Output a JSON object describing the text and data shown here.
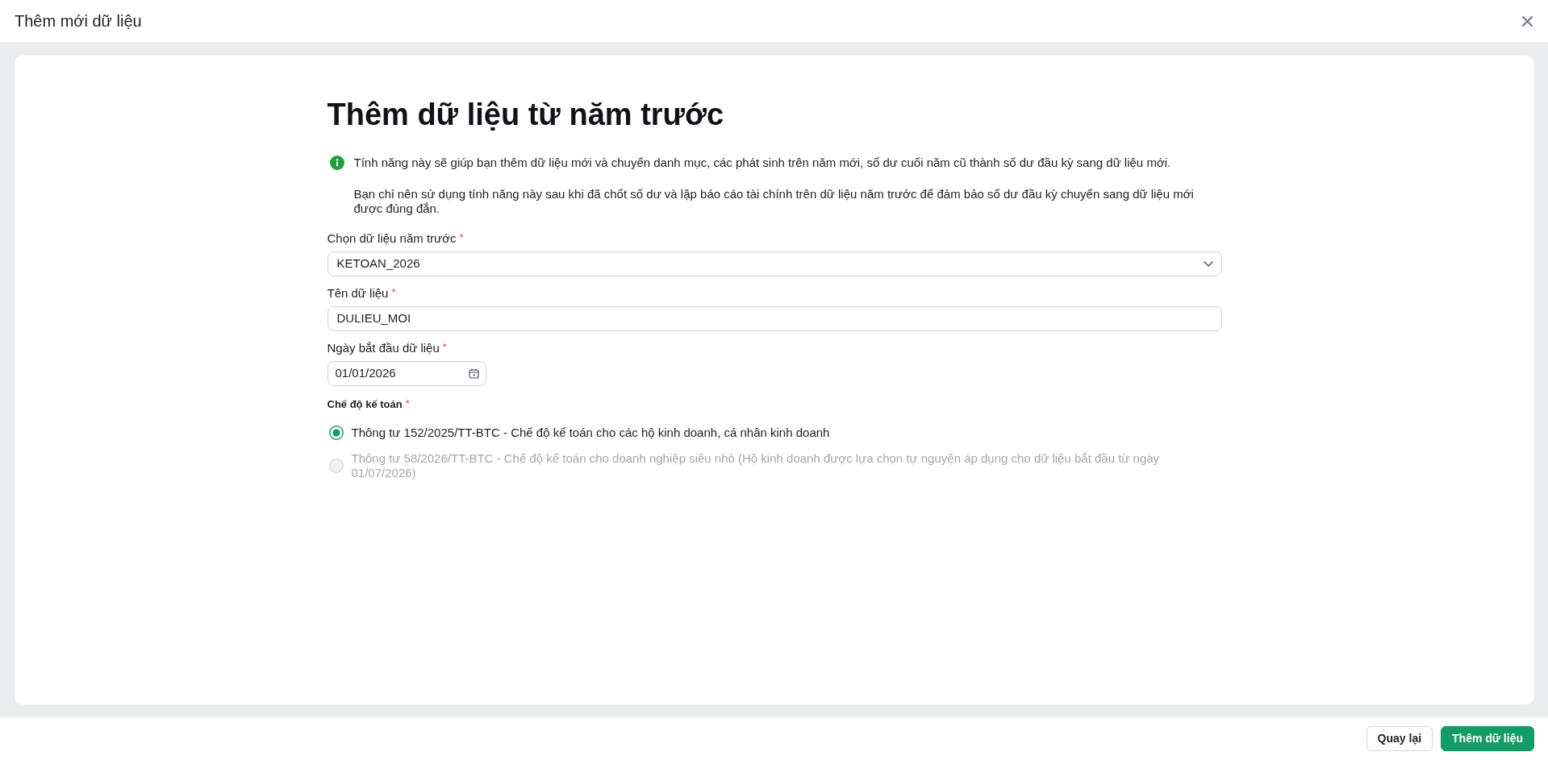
{
  "window": {
    "title": "Thêm mới dữ liệu"
  },
  "page": {
    "heading": "Thêm dữ liệu từ năm trước",
    "info": [
      "Tính năng này sẽ giúp bạn thêm dữ liệu mới và chuyển danh mục, các phát sinh trên năm mới, số dư cuối năm cũ thành số dư đầu kỳ sang dữ liệu mới.",
      "Bạn chỉ nên sử dụng tính năng này sau khi đã chốt số dư và lập báo cáo tài chính trên dữ liệu năm trước để đảm bảo số dư đầu kỳ chuyển sang dữ liệu mới được đúng đắn."
    ]
  },
  "form": {
    "fields": [
      {
        "kind": "select",
        "label": "Chọn dữ liệu năm trước",
        "required_mark": "*",
        "value": "KETOAN_2026"
      },
      {
        "kind": "text",
        "label": "Tên dữ liệu",
        "required_mark": "*",
        "value": "DULIEU_MOI"
      },
      {
        "kind": "date",
        "label": "Ngày bắt đầu dữ liệu",
        "required_mark": "*",
        "value": "01/01/2026"
      }
    ],
    "accounting_mode": {
      "label": "Chế độ kế toán",
      "required_mark": "*",
      "options": [
        {
          "label": "Thông tư 152/2025/TT-BTC - Chế độ kế toán cho các hộ kinh doanh, cá nhân kinh doanh",
          "selected": true,
          "disabled": false
        },
        {
          "label": "Thông tư 58/2026/TT-BTC - Chế độ kế toán cho doanh nghiệp siêu nhỏ (Hộ kinh doanh được lựa chọn tự nguyện áp dụng cho dữ liệu bắt đầu từ ngày 01/07/2026)",
          "selected": false,
          "disabled": true
        }
      ]
    }
  },
  "footer": {
    "buttons": [
      {
        "kind": "secondary",
        "label": "Quay lại"
      },
      {
        "kind": "primary",
        "label": "Thêm dữ liệu"
      }
    ]
  }
}
